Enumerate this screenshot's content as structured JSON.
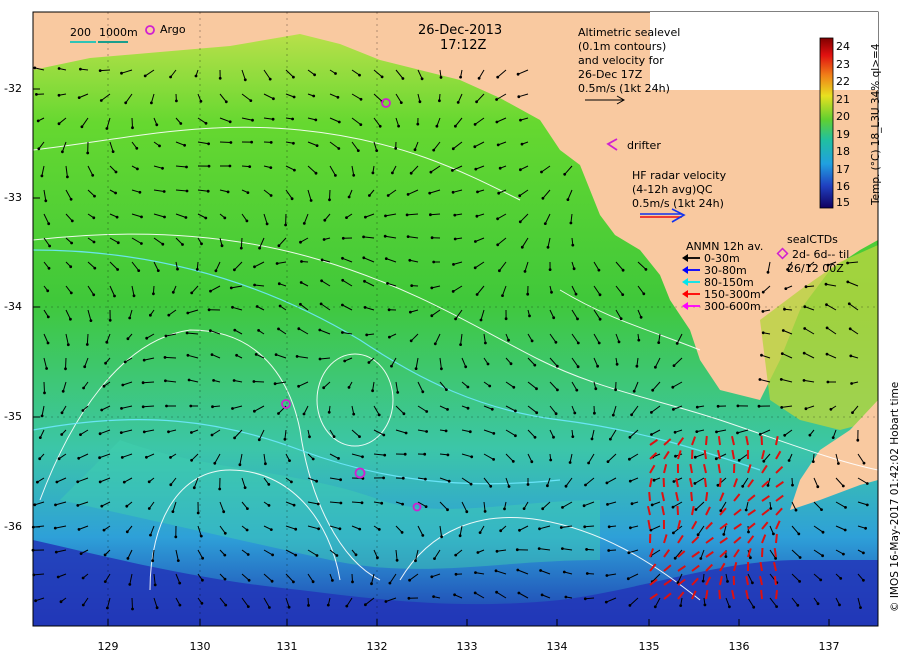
{
  "header": {
    "date": "26-Dec-2013",
    "time": "17:12Z"
  },
  "scale_legend": {
    "label_200": "200",
    "label_1000": "1000m",
    "argo_label": "Argo"
  },
  "altimetry_note": [
    "Altimetric sealevel",
    "(0.1m contours)",
    "and velocity for",
    "26-Dec 17Z",
    "0.5m/s (1kt 24h)"
  ],
  "drifter_label": "drifter",
  "hf_radar_note": [
    "HF radar velocity",
    "(4-12h avg)QC",
    "0.5m/s (1kt 24h)"
  ],
  "anmn_legend": {
    "title": "ANMN 12h av.",
    "items": [
      {
        "label": "0-30m",
        "color": "#000000"
      },
      {
        "label": "30-80m",
        "color": "#0000ff"
      },
      {
        "label": "80-150m",
        "color": "#00e5ee"
      },
      {
        "label": "150-300m",
        "color": "#ff0000"
      },
      {
        "label": "300-600m",
        "color": "#ff00ff"
      }
    ]
  },
  "seal_ctd": {
    "title": "sealCTDs",
    "line1": "2d- 6d-- til",
    "line2": "26/12 00Z"
  },
  "colorbar": {
    "title": "Temp. (°C) 18_L3U 34% ql>=4",
    "ticks": [
      "24",
      "23",
      "22",
      "21",
      "20",
      "19",
      "18",
      "17",
      "16",
      "15"
    ],
    "min": 15,
    "max": 24.5
  },
  "axes": {
    "lat_labels": [
      "-32",
      "-33",
      "-34",
      "-35",
      "-36"
    ],
    "lon_labels": [
      "129",
      "130",
      "131",
      "132",
      "133",
      "134",
      "135",
      "136",
      "137"
    ]
  },
  "credit": "© IMOS 16-May-2017 01:42:02 Hobart time",
  "colors": {
    "land": "#f9c9a0",
    "sst_green": "#55cc33",
    "sst_cyan": "#33bbdd",
    "sst_blue": "#2244bb",
    "contour": "#ffffff",
    "argo": "#d020d0",
    "hf_radar": "#dd1111"
  }
}
